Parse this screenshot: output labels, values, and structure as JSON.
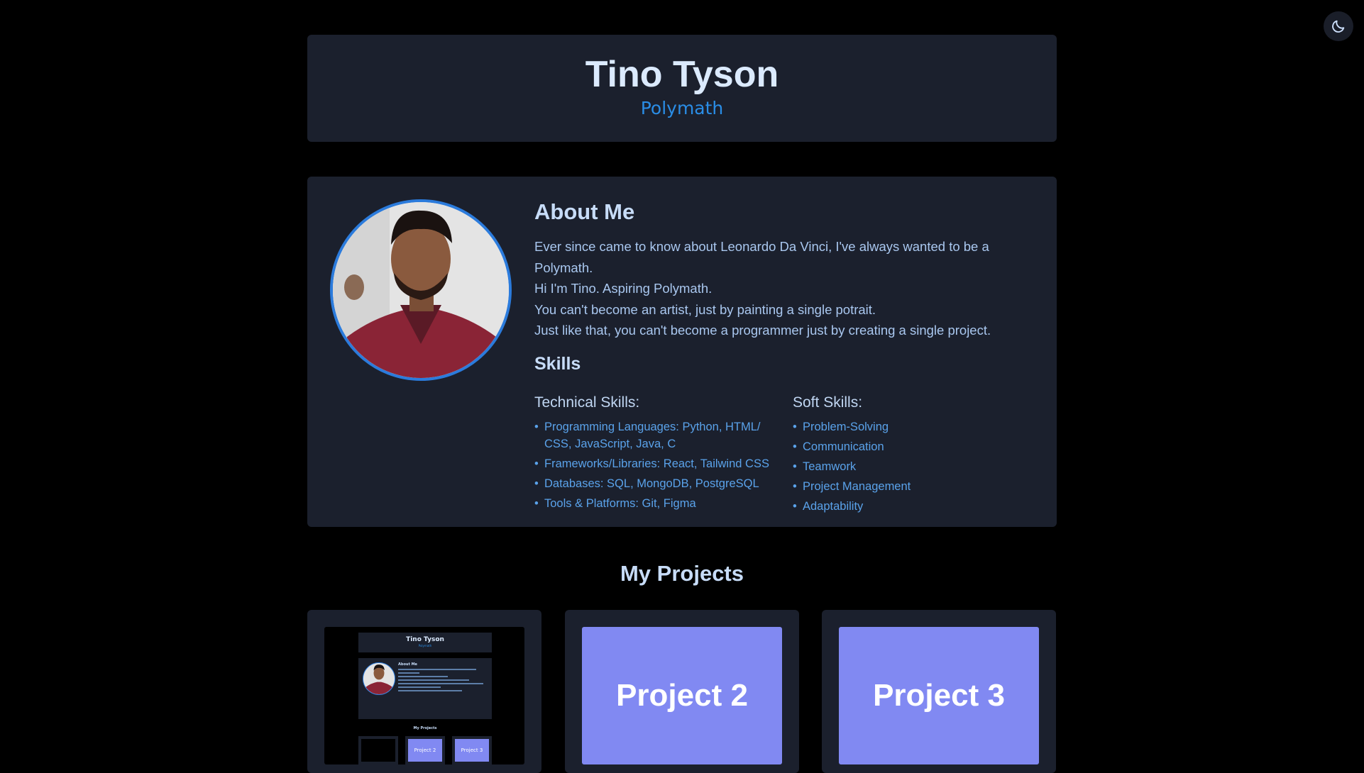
{
  "header": {
    "name": "Tino Tyson",
    "title": "Polymath"
  },
  "theme_toggle": {
    "icon": "moon-icon"
  },
  "about": {
    "heading": "About Me",
    "lines": [
      "Ever since came to know about Leonardo Da Vinci, I've always wanted to be a",
      "Polymath.",
      "Hi I'm Tino. Aspiring Polymath.",
      "You can't become an artist, just by painting a single potrait.",
      "Just like that, you can't become a programmer just by creating a single project."
    ],
    "skills_heading": "Skills",
    "technical": {
      "heading": "Technical Skills:",
      "items": [
        "Programming Languages: Python, HTML/ CSS, JavaScript, Java, C",
        "Frameworks/Libraries: React, Tailwind CSS",
        "Databases: SQL, MongoDB, PostgreSQL",
        "Tools & Platforms: Git, Figma"
      ]
    },
    "soft": {
      "heading": "Soft Skills:",
      "items": [
        "Problem-Solving",
        "Communication",
        "Teamwork",
        "Project Management",
        "Adaptability"
      ]
    }
  },
  "projects": {
    "heading": "My Projects",
    "items": [
      {
        "label": ""
      },
      {
        "label": "Project 2"
      },
      {
        "label": "Project 3"
      }
    ]
  },
  "colors": {
    "page_bg": "#000000",
    "card_bg": "#1b202d",
    "accent": "#2a8de6",
    "project_thumb": "#8189f2"
  }
}
